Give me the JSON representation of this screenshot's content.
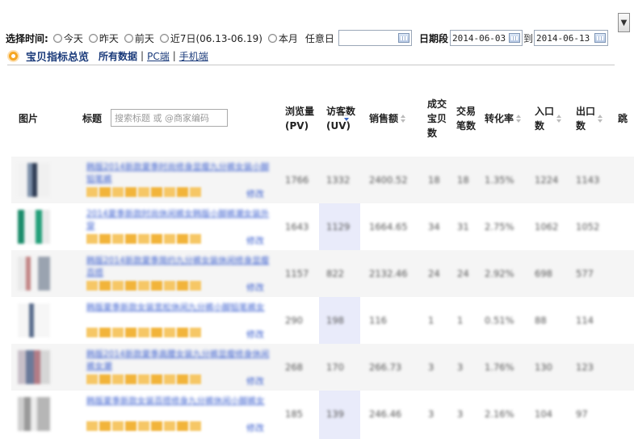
{
  "filter": {
    "label": "选择时间:",
    "options": [
      "今天",
      "昨天",
      "前天",
      "近7日(06.13-06.19)",
      "本月"
    ],
    "custom_day_label": "任意日",
    "range_label": "日期段",
    "range_start": "2014-06-03",
    "range_connector": "到",
    "range_end": "2014-06-13",
    "dropdown_glyph": "▼"
  },
  "section": {
    "title": "宝贝指标总览",
    "links": [
      "所有数据",
      "PC端",
      "手机端"
    ],
    "separator": "|"
  },
  "table": {
    "headers": {
      "image": "图片",
      "title": "标题",
      "pv": [
        "浏览量",
        "(PV)"
      ],
      "uv": [
        "访客数",
        "(UV)"
      ],
      "sales": "销售额",
      "items": [
        "成交",
        "宝贝",
        "数"
      ],
      "orders": [
        "交易",
        "笔数"
      ],
      "conversion": "转化率",
      "entries": [
        "入口",
        "数"
      ],
      "exits": [
        "出口",
        "数"
      ],
      "extra": "跳"
    },
    "search_placeholder": "搜索标题 或 @商家编码",
    "modify_label": "修改",
    "rows": [
      {
        "title": "韩版2014新款夏季时尚修身显瘦九分裤女装小脚铅笔裤",
        "pv": "1766",
        "uv": "1332",
        "sales": "2400.52",
        "items": "18",
        "orders": "18",
        "conversion": "1.35%",
        "entries": "1224",
        "exits": "1143"
      },
      {
        "title": "2014夏季新款时尚休闲裤女韩版小脚裤潮女装外穿",
        "pv": "1643",
        "uv": "1129",
        "sales": "1664.65",
        "items": "34",
        "orders": "31",
        "conversion": "2.75%",
        "entries": "1062",
        "exits": "1052"
      },
      {
        "title": "韩版2014新款夏季简约九分裤女装休闲修身显瘦百搭",
        "pv": "1157",
        "uv": "822",
        "sales": "2132.46",
        "items": "24",
        "orders": "24",
        "conversion": "2.92%",
        "entries": "698",
        "exits": "577"
      },
      {
        "title": "韩版夏季新款女装宽松休闲九分裤小脚铅笔裤女",
        "pv": "290",
        "uv": "198",
        "sales": "116",
        "items": "1",
        "orders": "1",
        "conversion": "0.51%",
        "entries": "88",
        "exits": "114"
      },
      {
        "title": "韩版2014新款夏季高腰女装九分裤显瘦修身休闲裤女潮",
        "pv": "268",
        "uv": "170",
        "sales": "266.73",
        "items": "3",
        "orders": "3",
        "conversion": "1.76%",
        "entries": "130",
        "exits": "123"
      },
      {
        "title": "韩版夏季新款女装百搭修身九分裤休闲小脚裤女",
        "pv": "185",
        "uv": "139",
        "sales": "246.46",
        "items": "3",
        "orders": "3",
        "conversion": "2.16%",
        "entries": "104",
        "exits": "97"
      }
    ]
  },
  "colors": {
    "link": "#3b5fcf",
    "section_title": "#1a3a7a",
    "uv_highlight": "#e9ebfa",
    "tag": "#f2b43a",
    "accent_dot": "#f5a623"
  }
}
